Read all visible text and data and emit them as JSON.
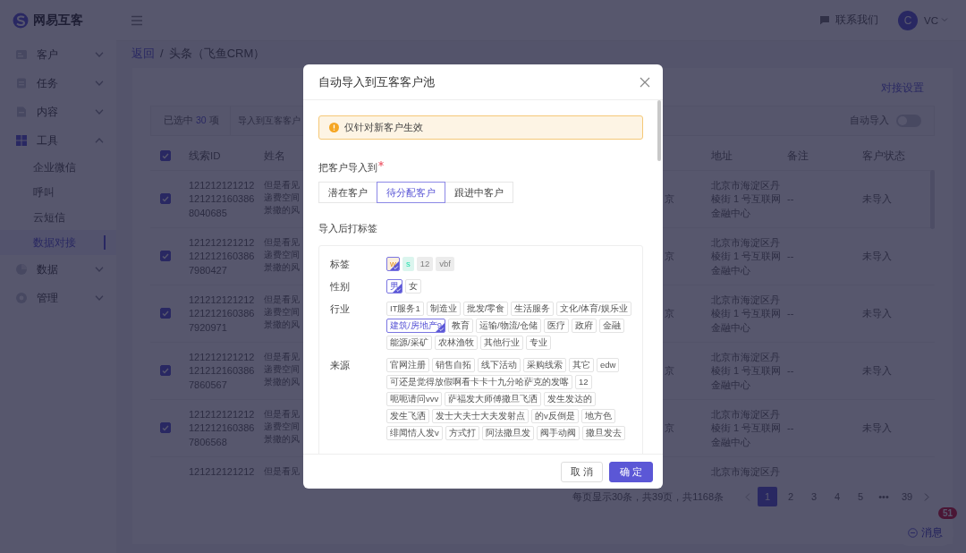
{
  "header": {
    "logo": "网易互客",
    "contact": "联系我们",
    "avatar": "C",
    "user": "VC"
  },
  "sidebar": {
    "items": [
      {
        "label": "客户",
        "expanded": false
      },
      {
        "label": "任务",
        "expanded": false
      },
      {
        "label": "内容",
        "expanded": false
      },
      {
        "label": "工具",
        "expanded": true,
        "children": [
          {
            "label": "企业微信",
            "selected": false
          },
          {
            "label": "呼叫",
            "selected": false
          },
          {
            "label": "云短信",
            "selected": false
          },
          {
            "label": "数据对接",
            "selected": true
          }
        ]
      },
      {
        "label": "数据",
        "expanded": false
      },
      {
        "label": "管理",
        "expanded": false
      }
    ]
  },
  "breadcrumb": {
    "items": [
      "返回",
      "头条（飞鱼CRM）"
    ],
    "separator": "/"
  },
  "card": {
    "settings_link": "对接设置",
    "selection": {
      "before": "已选中",
      "count": "30",
      "after": "项"
    },
    "import_button": "导入到互客客户",
    "auto_import": {
      "label": "自动导入",
      "on": false
    }
  },
  "table": {
    "header_checked": true,
    "columns": {
      "id": "线索ID",
      "name": "姓名",
      "address": "地址",
      "note": "备注",
      "status": "客户状态"
    },
    "rows": [
      {
        "checked": true,
        "id": "1212121212121212121603868040685",
        "name": "但是看见递费空间景撒的风",
        "column_4": "京",
        "address": "北京市海淀区丹棱街 1 号互联网金融中心",
        "note": "--",
        "status": "未导入"
      },
      {
        "checked": true,
        "id": "1212121212121212121603867980427",
        "name": "但是看见递费空间景撒的风",
        "column_4": "京",
        "address": "北京市海淀区丹棱街 1 号互联网金融中心",
        "note": "--",
        "status": "未导入"
      },
      {
        "checked": true,
        "id": "1212121212121212121603867920971",
        "name": "但是看见递费空间景撒的风",
        "column_4": "京",
        "address": "北京市海淀区丹棱街 1 号互联网金融中心",
        "note": "--",
        "status": "未导入"
      },
      {
        "checked": true,
        "id": "1212121212121212121603867860567",
        "name": "但是看见递费空间景撒的风",
        "column_4": "京",
        "address": "北京市海淀区丹棱街 1 号互联网金融中心",
        "note": "--",
        "status": "未导入"
      },
      {
        "checked": true,
        "id": "1212121212121212121603867806568",
        "name": "但是看见递费空间景撒的风",
        "column_4": "京",
        "address": "北京市海淀区丹棱街 1 号互联网金融中心",
        "note": "--",
        "status": "未导入"
      },
      {
        "id": "121212121212",
        "name": "但是看见",
        "address": "北京市海淀区丹"
      }
    ]
  },
  "pagination": {
    "summary": "每页显示30条，共39页，共1168条",
    "pages": [
      {
        "label": "1",
        "selected": true
      },
      {
        "label": "2",
        "selected": false
      },
      {
        "label": "3",
        "selected": false
      },
      {
        "label": "4",
        "selected": false
      },
      {
        "label": "5",
        "selected": false
      },
      {
        "label": "•••",
        "selected": false
      },
      {
        "label": "39",
        "selected": false
      }
    ]
  },
  "chat": {
    "label": "消息",
    "badge": "51"
  },
  "modal": {
    "title": "自动导入到互客客户池",
    "alert": "仅针对新客户生效",
    "target_label": "把客户导入到",
    "required": true,
    "targets": [
      {
        "label": "潜在客户",
        "selected": false
      },
      {
        "label": "待分配客户",
        "selected": true
      },
      {
        "label": "跟进中客户",
        "selected": false
      }
    ],
    "tags_label": "导入后打标签",
    "tag_groups": [
      {
        "label": "标签",
        "tags": [
          {
            "label": "w",
            "selected": true,
            "color": "#fdefdc"
          },
          {
            "label": "s",
            "selected": false,
            "color": "#dbf5ee"
          },
          {
            "label": "12",
            "selected": false,
            "color": "#ececec"
          },
          {
            "label": "vbf",
            "selected": false,
            "color": "#ececec"
          }
        ]
      },
      {
        "label": "性别",
        "tags": [
          {
            "label": "男",
            "selected": true
          },
          {
            "label": "女",
            "selected": false
          }
        ]
      },
      {
        "label": "行业",
        "tags": [
          {
            "label": "IT服务1",
            "selected": false
          },
          {
            "label": "制造业",
            "selected": false
          },
          {
            "label": "批发/零食",
            "selected": false
          },
          {
            "label": "生活服务",
            "selected": false
          },
          {
            "label": "文化/体育/娱乐业",
            "selected": false
          },
          {
            "label": "建筑/房地产9",
            "selected": true
          },
          {
            "label": "教育",
            "selected": false
          },
          {
            "label": "运输/物流/仓储",
            "selected": false
          },
          {
            "label": "医疗",
            "selected": false
          },
          {
            "label": "政府",
            "selected": false
          },
          {
            "label": "金融",
            "selected": false
          },
          {
            "label": "能源/采矿",
            "selected": false
          },
          {
            "label": "农林渔牧",
            "selected": false
          },
          {
            "label": "其他行业",
            "selected": false
          },
          {
            "label": "专业",
            "selected": false
          }
        ]
      },
      {
        "label": "来源",
        "tags": [
          {
            "label": "官网注册",
            "selected": false
          },
          {
            "label": "销售自拓",
            "selected": false
          },
          {
            "label": "线下活动",
            "selected": false
          },
          {
            "label": "采购线索",
            "selected": false
          },
          {
            "label": "其它",
            "selected": false
          },
          {
            "label": "edw",
            "selected": false
          },
          {
            "label": "可还是觉得放假啊看卡卡十九分哈萨克的发喀",
            "selected": false
          },
          {
            "label": "12",
            "selected": false
          },
          {
            "label": "呃呃请问vvv",
            "selected": false
          },
          {
            "label": "萨福发大师傅撒旦飞洒",
            "selected": false
          },
          {
            "label": "发生发达的",
            "selected": false
          },
          {
            "label": "发生飞洒",
            "selected": false
          },
          {
            "label": "发士大夫士大夫发射点",
            "selected": false
          },
          {
            "label": "的v反倒是",
            "selected": false
          },
          {
            "label": "地方色",
            "selected": false
          },
          {
            "label": "绯闻情人发v",
            "selected": false
          },
          {
            "label": "方式打",
            "selected": false
          },
          {
            "label": "阿法撒旦发",
            "selected": false
          },
          {
            "label": "阀手动阀",
            "selected": false
          },
          {
            "label": "撒旦发去",
            "selected": false
          }
        ]
      }
    ],
    "buttons": {
      "cancel": "取 消",
      "confirm": "确 定"
    }
  }
}
